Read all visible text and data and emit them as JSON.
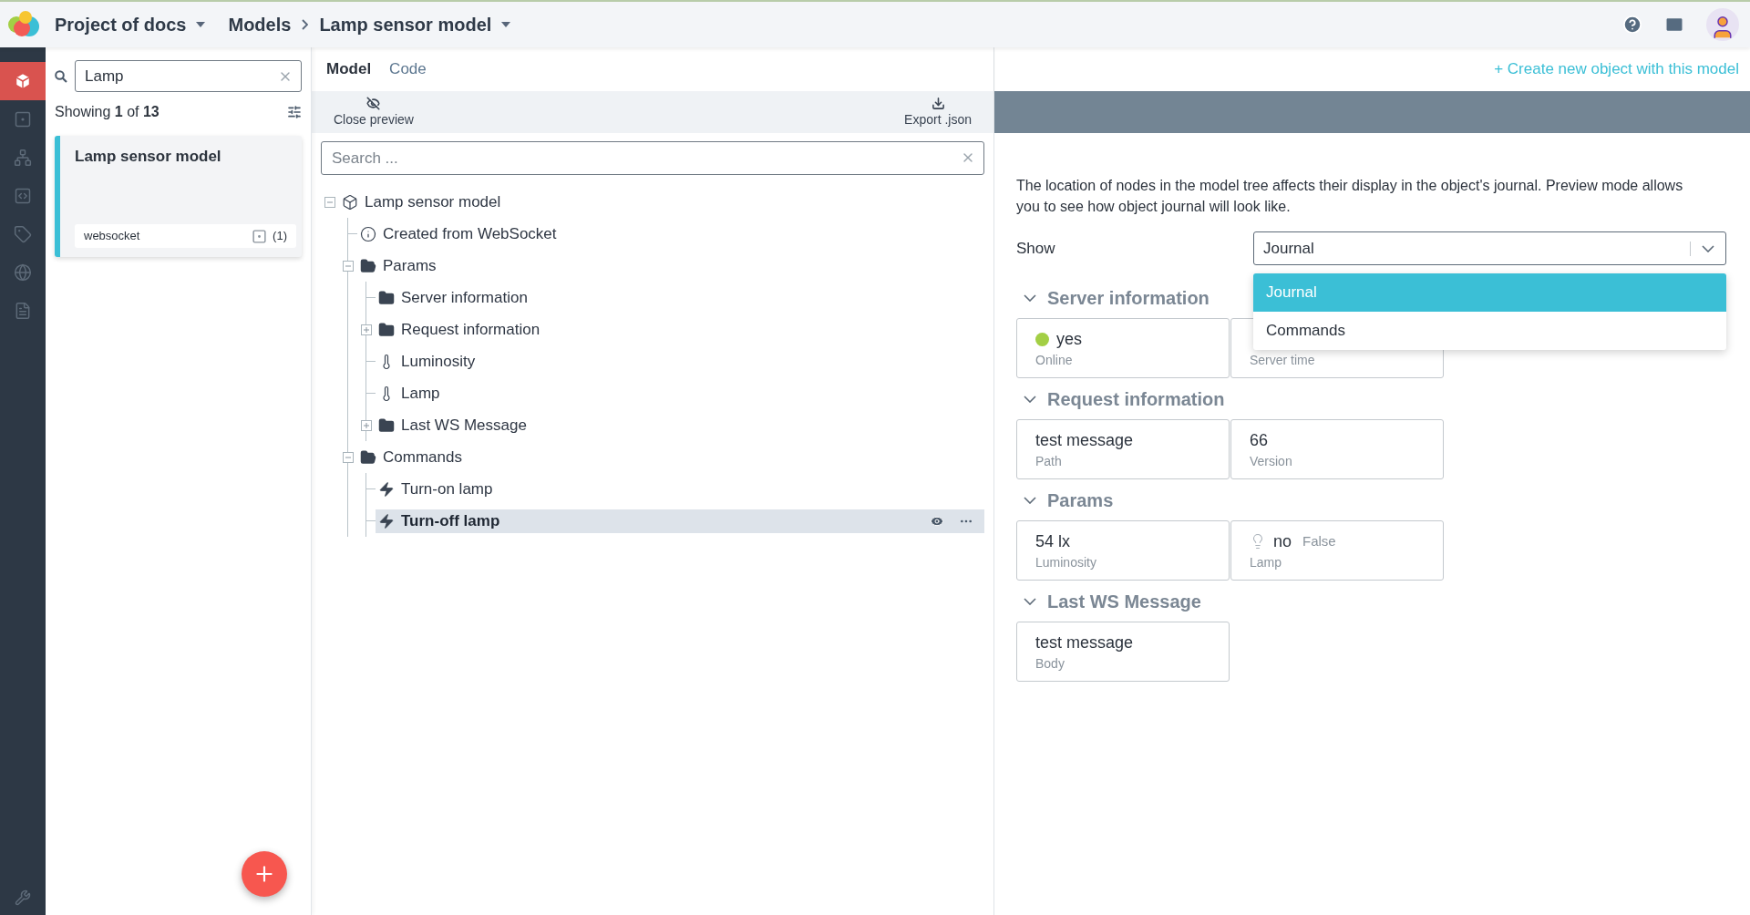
{
  "header": {
    "project": "Project of docs",
    "section": "Models",
    "model": "Lamp sensor model"
  },
  "nav": {
    "items": [
      {
        "kind": "cube",
        "selected": true
      },
      {
        "kind": "widget",
        "selected": false
      },
      {
        "kind": "hierarchy",
        "selected": false
      },
      {
        "kind": "code",
        "selected": false
      },
      {
        "kind": "tag",
        "selected": false
      },
      {
        "kind": "globe",
        "selected": false
      },
      {
        "kind": "document",
        "selected": false
      }
    ]
  },
  "list": {
    "search": {
      "value": "Lamp"
    },
    "showing": "Showing **1** of **13**",
    "cards": [
      {
        "title": "Lamp sensor model",
        "tag": "websocket",
        "count": "(1)",
        "selected": true
      }
    ]
  },
  "editor": {
    "tabs": [
      {
        "label": "Model",
        "selected": true
      },
      {
        "label": "Code",
        "selected": false
      }
    ],
    "toolbar": [
      {
        "kind": "hide",
        "label": "Close preview"
      },
      {
        "kind": "download",
        "label": "Export .json"
      }
    ],
    "search": {
      "placeholder": "Search ..."
    },
    "tree": [
      {
        "kind": "model",
        "label": "Lamp sensor model",
        "expanded": true,
        "selected": false,
        "children": [
          {
            "kind": "info",
            "label": "Created from WebSocket",
            "selected": false
          },
          {
            "kind": "folder",
            "label": "Params",
            "expanded": true,
            "selected": false,
            "children": [
              {
                "kind": "folder",
                "label": "Server information",
                "selected": false
              },
              {
                "kind": "folder",
                "label": "Request information",
                "expanded": false,
                "selected": false
              },
              {
                "kind": "sensor",
                "label": "Luminosity",
                "selected": false
              },
              {
                "kind": "sensor",
                "label": "Lamp",
                "selected": false
              },
              {
                "kind": "folder",
                "label": "Last WS Message",
                "expanded": false,
                "selected": false
              }
            ]
          },
          {
            "kind": "folder",
            "label": "Commands",
            "expanded": true,
            "selected": false,
            "children": [
              {
                "kind": "command",
                "label": "Turn-on lamp",
                "selected": false
              },
              {
                "kind": "command",
                "label": "Turn-off lamp",
                "selected": true
              }
            ]
          }
        ]
      }
    ]
  },
  "preview": {
    "create_link": "+ Create new object with this model",
    "description": "The location of nodes in the model tree affects their display in the object's journal. Preview mode allows you to see how object journal will look like.",
    "show": {
      "label": "Show",
      "value": "Journal",
      "options": [
        {
          "label": "Journal",
          "selected": true
        },
        {
          "label": "Commands",
          "selected": false
        }
      ]
    },
    "sections": [
      {
        "title": "Server information",
        "expanded": true,
        "fields": [
          {
            "kind": "status",
            "value": "yes",
            "color": "#a3cf45",
            "label": "Online"
          },
          {
            "kind": "text",
            "label": "Server time"
          }
        ]
      },
      {
        "title": "Request information",
        "expanded": true,
        "fields": [
          {
            "kind": "text",
            "value": "test message",
            "label": "Path"
          },
          {
            "kind": "text",
            "value": "66",
            "label": "Version"
          }
        ]
      },
      {
        "title": "Params",
        "expanded": true,
        "fields": [
          {
            "kind": "text",
            "value": "54 lx",
            "label": "Luminosity"
          },
          {
            "kind": "bool",
            "value": "no",
            "note": "False",
            "on": false,
            "label": "Lamp"
          }
        ]
      },
      {
        "title": "Last WS Message",
        "expanded": true,
        "fields": [
          {
            "kind": "text",
            "value": "test message",
            "label": "Body"
          }
        ]
      }
    ]
  }
}
